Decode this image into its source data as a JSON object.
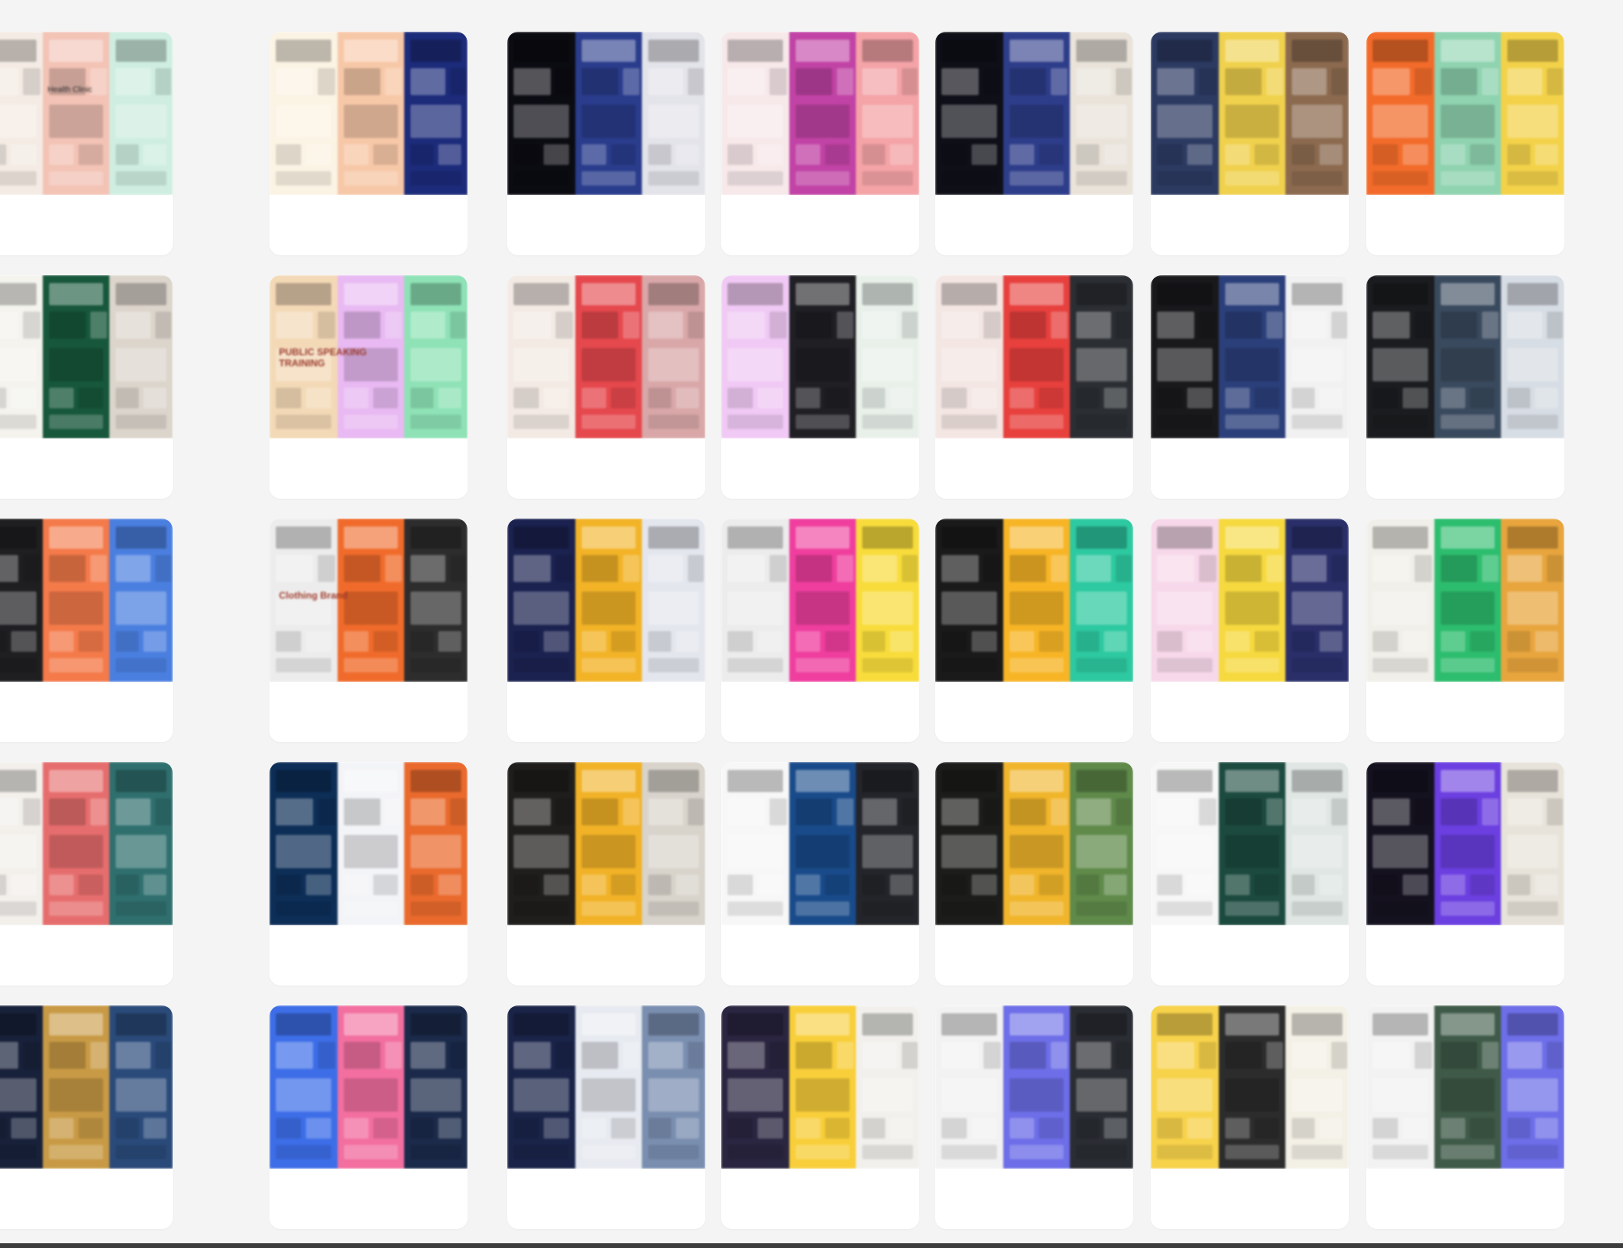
{
  "page": {
    "background": "#f4f4f5",
    "card_background": "#ffffff"
  },
  "gallery": {
    "cards": [
      {
        "theme": "light peach template",
        "tint": [
          "#f4ebe4",
          "#f3c3b6",
          "#cfeee1"
        ],
        "title": "",
        "text": "Health Clinic"
      },
      {
        "theme": "cream template",
        "tint": [
          "#fbf3e4",
          "#f7c8a8",
          "#1c2b7a"
        ],
        "title": "",
        "text": ""
      },
      {
        "theme": "dark tech template",
        "tint": [
          "#0b0b12",
          "#2a3c8c",
          "#e3e3ea"
        ],
        "title": "",
        "text": ""
      },
      {
        "theme": "pink purple template",
        "tint": [
          "#f7e8ea",
          "#c143a5",
          "#f4a3a6"
        ],
        "title": "",
        "text": ""
      },
      {
        "theme": "dark blue template",
        "tint": [
          "#0f0f18",
          "#2e3d8a",
          "#e9e3da"
        ],
        "title": "",
        "text": ""
      },
      {
        "theme": "navy yellow template",
        "tint": [
          "#2c3a62",
          "#f0d14d",
          "#8b6a4f"
        ],
        "title": "",
        "text": ""
      },
      {
        "theme": "orange green template",
        "tint": [
          "#f26b2a",
          "#8fd3b0",
          "#f3d24a"
        ],
        "title": "",
        "text": ""
      },
      {
        "theme": "green business template",
        "tint": [
          "#f4f3ee",
          "#17573b",
          "#dcd5cc"
        ],
        "title": "",
        "text": ""
      },
      {
        "theme": "pastel speaking template",
        "tint": [
          "#f3d9b6",
          "#e8b9f2",
          "#8ee2b6"
        ],
        "title": "PUBLIC SPEAKING TRAINING",
        "text": ""
      },
      {
        "theme": "rose photo template",
        "tint": [
          "#f3eae4",
          "#e5484d",
          "#d9a7a8"
        ],
        "title": "",
        "text": ""
      },
      {
        "theme": "lilac dark template",
        "tint": [
          "#f0c9f4",
          "#1f1f24",
          "#e9f0ea"
        ],
        "title": "",
        "text": ""
      },
      {
        "theme": "red gray template",
        "tint": [
          "#f3e6e3",
          "#e7403d",
          "#2b2e33"
        ],
        "title": "",
        "text": ""
      },
      {
        "theme": "dark gradient template",
        "tint": [
          "#19191c",
          "#2b3f7a",
          "#f1f1f1"
        ],
        "title": "",
        "text": ""
      },
      {
        "theme": "dark automotive template",
        "tint": [
          "#1b1c1f",
          "#3a4a5e",
          "#d7dde4"
        ],
        "title": "",
        "text": ""
      },
      {
        "theme": "dark orange template",
        "tint": [
          "#1f1f22",
          "#f47a4a",
          "#4a7fe0"
        ],
        "title": "",
        "text": ""
      },
      {
        "theme": "gray orange template",
        "tint": [
          "#ececec",
          "#f06b2b",
          "#2d2d2d"
        ],
        "title": "Clothing Brand",
        "text": ""
      },
      {
        "theme": "navy yellow architecture",
        "tint": [
          "#1b2250",
          "#f2b327",
          "#e4e6ee"
        ],
        "title": "",
        "text": ""
      },
      {
        "theme": "gray magenta template",
        "tint": [
          "#ececec",
          "#ef3e9e",
          "#f8dc3c"
        ],
        "title": "",
        "text": ""
      },
      {
        "theme": "yellow black template",
        "tint": [
          "#1a1a1a",
          "#f7b526",
          "#2dc9a0"
        ],
        "title": "",
        "text": ""
      },
      {
        "theme": "pink yellow template",
        "tint": [
          "#f7d8ea",
          "#f6d93f",
          "#2a2f6a"
        ],
        "title": "",
        "text": ""
      },
      {
        "theme": "food green template",
        "tint": [
          "#f1efe9",
          "#2dbd6e",
          "#e8a53d"
        ],
        "title": "",
        "text": ""
      },
      {
        "theme": "collage template",
        "tint": [
          "#f3f0ec",
          "#e66d6d",
          "#2f6f6e"
        ],
        "title": "",
        "text": ""
      },
      {
        "theme": "ocean blue template",
        "tint": [
          "#0d2e57",
          "#f3f4f7",
          "#ea6a2d"
        ],
        "title": "",
        "text": ""
      },
      {
        "theme": "dark yellow template",
        "tint": [
          "#1f1e1c",
          "#f1b227",
          "#d8d3cb"
        ],
        "title": "",
        "text": ""
      },
      {
        "theme": "sea white template",
        "tint": [
          "#f7f7f7",
          "#194b8a",
          "#23252a"
        ],
        "title": "",
        "text": ""
      },
      {
        "theme": "forest dark template",
        "tint": [
          "#1c1d1b",
          "#f0b52b",
          "#5f8a4a"
        ],
        "title": "",
        "text": ""
      },
      {
        "theme": "teal white template",
        "tint": [
          "#f6f7f6",
          "#1c4a3f",
          "#dfe6e3"
        ],
        "title": "",
        "text": ""
      },
      {
        "theme": "purple dark template",
        "tint": [
          "#15121f",
          "#6b3fe0",
          "#e8e3da"
        ],
        "title": "",
        "text": ""
      },
      {
        "theme": "dark navy template",
        "tint": [
          "#18213a",
          "#c89a45",
          "#2a4a7a"
        ],
        "title": "",
        "text": ""
      },
      {
        "theme": "blue flower template",
        "tint": [
          "#3d6ee8",
          "#f26fa0",
          "#1b2a4a"
        ],
        "title": "",
        "text": ""
      },
      {
        "theme": "navy photo template",
        "tint": [
          "#1a2449",
          "#e7eaf0",
          "#7a8eb0"
        ],
        "title": "",
        "text": ""
      },
      {
        "theme": "purple yellow template",
        "tint": [
          "#2a2540",
          "#f8cf3a",
          "#f1f0ec"
        ],
        "title": "",
        "text": ""
      },
      {
        "theme": "business blue template",
        "tint": [
          "#f2f2f2",
          "#6d6ee8",
          "#2a2d33"
        ],
        "title": "",
        "text": ""
      },
      {
        "theme": "yellow gradient template",
        "tint": [
          "#f7d24b",
          "#2c2c2c",
          "#f3f0e6"
        ],
        "title": "",
        "text": ""
      },
      {
        "theme": "green gray template",
        "tint": [
          "#f2f2f2",
          "#3f5a48",
          "#6d6ee8"
        ],
        "title": "",
        "text": ""
      }
    ]
  }
}
